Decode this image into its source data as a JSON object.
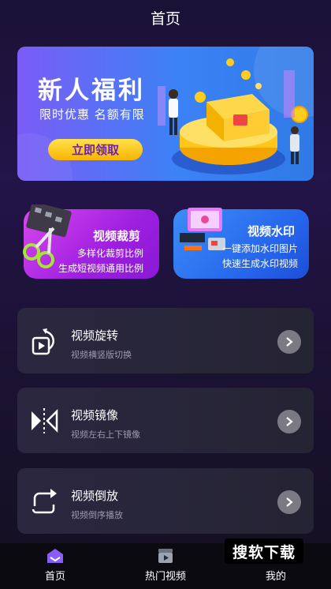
{
  "header": {
    "title": "首页"
  },
  "banner": {
    "title": "新人福利",
    "subtitle": "限时优惠  名额有限",
    "button_label": "立即领取"
  },
  "features": {
    "crop": {
      "title": "视频裁剪",
      "line1": "多样化裁剪比例",
      "line2": "生成短视频通用比例"
    },
    "watermark": {
      "title": "视频水印",
      "line1": "一键添加水印图片",
      "line2": "快速生成水印视频"
    }
  },
  "tools": [
    {
      "title": "视频旋转",
      "subtitle": "视频横竖版切换",
      "icon": "rotate-video-icon"
    },
    {
      "title": "视频镜像",
      "subtitle": "视频左右上下镜像",
      "icon": "mirror-icon"
    },
    {
      "title": "视频倒放",
      "subtitle": "视频倒序播放",
      "icon": "reverse-icon"
    }
  ],
  "tabbar": {
    "items": [
      {
        "label": "首页",
        "icon": "home-icon",
        "active": true
      },
      {
        "label": "热门视频",
        "icon": "clapperboard-icon",
        "active": false
      },
      {
        "label": "我的",
        "icon": "user-icon",
        "active": false
      }
    ]
  },
  "overlay": {
    "text": "搜软下载"
  },
  "colors": {
    "banner_start": "#7b5cf6",
    "banner_end": "#2e7ae6",
    "crop_card": "#c03cec",
    "watermark_card": "#2563eb",
    "button_yellow": "#ffd52e",
    "chevron_gray": "#7b7a84"
  }
}
